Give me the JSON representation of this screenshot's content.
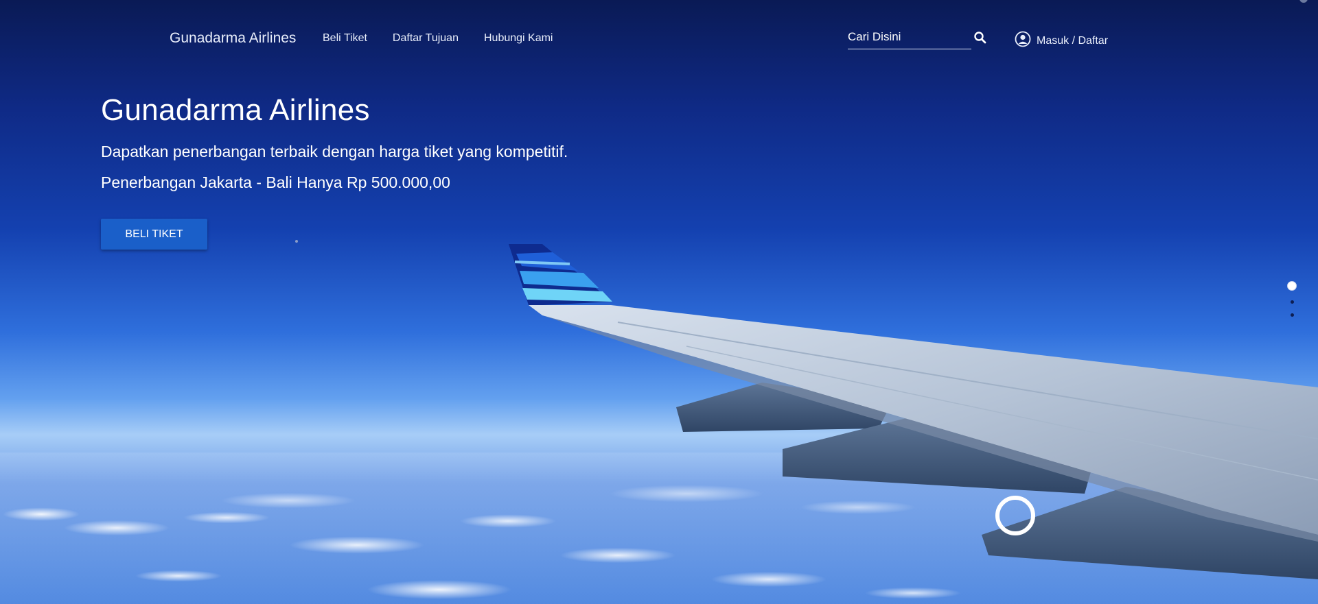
{
  "navbar": {
    "brand": "Gunadarma Airlines",
    "links": [
      {
        "label": "Beli Tiket"
      },
      {
        "label": "Daftar Tujuan"
      },
      {
        "label": "Hubungi Kami"
      }
    ],
    "search_placeholder": "Cari Disini",
    "account_label": "Masuk / Daftar"
  },
  "hero": {
    "title": "Gunadarma Airlines",
    "subtitle1": "Dapatkan penerbangan terbaik dengan harga tiket yang kompetitif.",
    "subtitle2": "Penerbangan Jakarta - Bali Hanya Rp 500.000,00",
    "cta_label": "BELI TIKET"
  },
  "carousel": {
    "slides": 3,
    "active_index": 0
  },
  "colors": {
    "accent": "#1a5fc9",
    "sky_top": "#0a1a55"
  }
}
